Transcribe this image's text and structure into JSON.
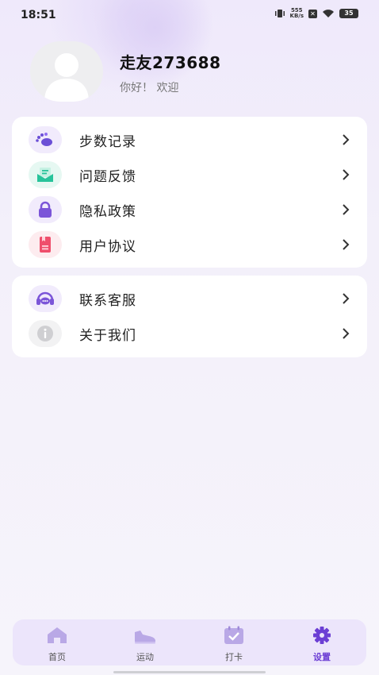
{
  "status_bar": {
    "time": "18:51",
    "net_speed_value": "555",
    "net_speed_unit": "KB/s",
    "battery": "35"
  },
  "profile": {
    "username": "走友273688",
    "greeting": "你好！ 欢迎"
  },
  "menu_group_1": [
    {
      "label": "步数记录",
      "icon": "footprint-icon",
      "color": "#6b4fd6"
    },
    {
      "label": "问题反馈",
      "icon": "feedback-icon",
      "color": "#27c39a"
    },
    {
      "label": "隐私政策",
      "icon": "lock-icon",
      "color": "#7b55d8"
    },
    {
      "label": "用户协议",
      "icon": "document-icon",
      "color": "#ef4f6c"
    }
  ],
  "menu_group_2": [
    {
      "label": "联系客服",
      "icon": "headset-icon",
      "color": "#7b55d8"
    },
    {
      "label": "关于我们",
      "icon": "info-icon",
      "color": "#cfcfd2"
    }
  ],
  "tabs": [
    {
      "label": "首页",
      "icon": "home-icon",
      "active": false
    },
    {
      "label": "运动",
      "icon": "sneaker-icon",
      "active": false
    },
    {
      "label": "打卡",
      "icon": "calendar-check-icon",
      "active": false
    },
    {
      "label": "设置",
      "icon": "gear-icon",
      "active": true
    }
  ],
  "colors": {
    "accent": "#6c3fd4",
    "tab_inactive": "#b9a8e6",
    "background": "#f3f0fa"
  }
}
